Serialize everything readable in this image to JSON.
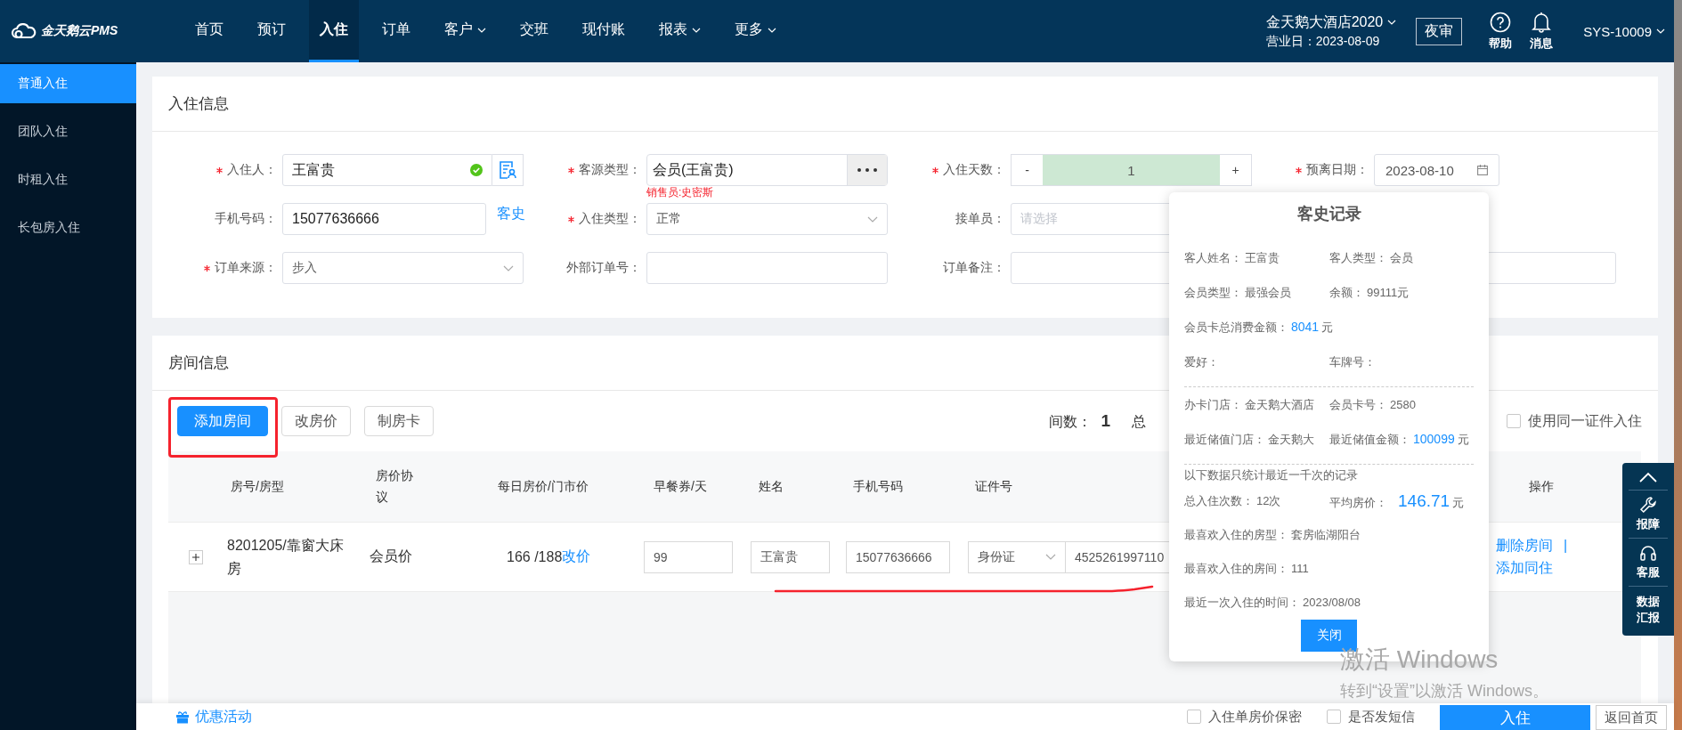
{
  "brand": {
    "name": "金天鹅云PMS"
  },
  "nav": {
    "items": [
      {
        "label": "首页",
        "selected": false,
        "dropdown": false
      },
      {
        "label": "预订",
        "selected": false,
        "dropdown": false
      },
      {
        "label": "入住",
        "selected": true,
        "dropdown": false
      },
      {
        "label": "订单",
        "selected": false,
        "dropdown": false
      },
      {
        "label": "客户",
        "selected": false,
        "dropdown": true
      },
      {
        "label": "交班",
        "selected": false,
        "dropdown": false
      },
      {
        "label": "现付账",
        "selected": false,
        "dropdown": false
      },
      {
        "label": "报表",
        "selected": false,
        "dropdown": true
      },
      {
        "label": "更多",
        "selected": false,
        "dropdown": true
      }
    ],
    "hotel": "金天鹅大酒店2020",
    "business_date": "营业日：2023-08-09",
    "night_audit": "夜审",
    "help": "帮助",
    "messages": "消息",
    "user": "SYS-10009"
  },
  "sidebar": {
    "items": [
      {
        "label": "普通入住",
        "selected": true
      },
      {
        "label": "团队入住",
        "selected": false
      },
      {
        "label": "时租入住",
        "selected": false
      },
      {
        "label": "长包房入住",
        "selected": false
      }
    ]
  },
  "checkin_info": {
    "title": "入住信息",
    "rows": [
      [
        {
          "kind": "input",
          "label": "入住人：",
          "required": true,
          "value": "王富贵",
          "verified": true,
          "reader": true
        },
        {
          "kind": "picker",
          "label": "客源类型：",
          "required": true,
          "value": "会员(王富贵)",
          "note": "销售员:史密斯"
        },
        {
          "kind": "stepper",
          "label": "入住天数：",
          "required": true,
          "value": "1",
          "minus": "-",
          "plus": "+"
        },
        {
          "kind": "date",
          "label": "预离日期：",
          "required": true,
          "value": "2023-08-10"
        }
      ],
      [
        {
          "kind": "input",
          "label": "手机号码：",
          "required": false,
          "value": "15077636666",
          "link": "客史"
        },
        {
          "kind": "select",
          "label": "入住类型：",
          "required": true,
          "value": "正常"
        },
        {
          "kind": "select",
          "label": "接单员：",
          "required": false,
          "placeholder": "请选择"
        }
      ],
      [
        {
          "kind": "select",
          "label": "订单来源：",
          "required": true,
          "value": "步入"
        },
        {
          "kind": "input",
          "label": "外部订单号：",
          "required": false
        },
        {
          "kind": "input",
          "label": "订单备注：",
          "required": false,
          "wide": true
        }
      ]
    ]
  },
  "room_info": {
    "title": "房间信息",
    "buttons": [
      {
        "label": "添加房间",
        "primary": true,
        "highlighted": true
      },
      {
        "label": "改房价",
        "primary": false,
        "highlighted": false
      },
      {
        "label": "制房卡",
        "primary": false,
        "highlighted": false
      }
    ],
    "count_label": "间数：",
    "count": "1",
    "total_label": "总",
    "same_id": {
      "label": "使用同一证件入住",
      "checked": false
    },
    "columns": [
      "房号/房型",
      "房价协议",
      "每日房价/门市价",
      "早餐券/天",
      "姓名",
      "手机号码",
      "证件号",
      "操作"
    ],
    "rows": [
      {
        "room": "8201205/靠窗大床房",
        "protocol": "会员价",
        "price": "166 /188",
        "change_price": "改价",
        "breakfast": "99",
        "name": "王富贵",
        "phone": "15077636666",
        "id_type": "身份证",
        "id_number": "4525261997110",
        "actions": [
          "删除房间",
          "添加同住"
        ],
        "separator": "|",
        "underlined": true
      }
    ]
  },
  "guest_history": {
    "title": "客史记录",
    "close": "关闭",
    "sections": [
      {
        "lines": [
          [
            {
              "kind": "plain",
              "label": "客人姓名：",
              "value": "王富贵"
            },
            {
              "kind": "plain",
              "label": "客人类型：",
              "value": "会员"
            }
          ],
          [
            {
              "kind": "plain",
              "label": "会员类型：",
              "value": "最强会员"
            },
            {
              "kind": "plain",
              "label": "余额：",
              "value": "99111元"
            }
          ],
          [
            {
              "kind": "amount",
              "label": "会员卡总消费金额：",
              "value": "8041",
              "unit": "元"
            }
          ],
          [
            {
              "kind": "plain",
              "label": "爱好："
            },
            {
              "kind": "plain",
              "label": "车牌号："
            }
          ]
        ]
      },
      {
        "lines": [
          [
            {
              "kind": "plain",
              "label": "办卡门店：",
              "value": "金天鹅大酒店"
            },
            {
              "kind": "plain",
              "label": "会员卡号：",
              "value": "2580"
            }
          ],
          [
            {
              "kind": "plain",
              "label": "最近储值门店：",
              "value": "金天鹅大"
            },
            {
              "kind": "amount",
              "label": "最近储值金额：",
              "value": "100099",
              "unit": "元"
            }
          ]
        ]
      },
      {
        "note": "以下数据只统计最近一千次的记录",
        "lines": [
          [
            {
              "kind": "plain",
              "label": "总入住次数：",
              "value": "12次"
            },
            {
              "kind": "big-amount",
              "label": "平均房价：",
              "value": "146.71",
              "unit": "元"
            }
          ],
          [
            {
              "kind": "plain",
              "label": "最喜欢入住的房型：",
              "value": "套房临湖阳台"
            }
          ],
          [
            {
              "kind": "plain",
              "label": "最喜欢入住的房间：",
              "value": "111"
            }
          ],
          [
            {
              "kind": "plain",
              "label": "最近一次入住的时间：",
              "value": "2023/08/08"
            }
          ]
        ]
      }
    ]
  },
  "side_tools": [
    {
      "kind": "top"
    },
    {
      "kind": "repair",
      "label": "报障"
    },
    {
      "kind": "service",
      "label": "客服"
    },
    {
      "kind": "report",
      "label": "数据汇报"
    }
  ],
  "footer": {
    "promo": "优惠活动",
    "options": [
      {
        "label": "入住单房价保密",
        "checked": false
      },
      {
        "label": "是否发短信",
        "checked": false
      }
    ],
    "submit": "入住",
    "back": "返回首页"
  },
  "os_notice": {
    "title": "激活 Windows",
    "hint": "转到“设置”以激活 Windows。"
  }
}
